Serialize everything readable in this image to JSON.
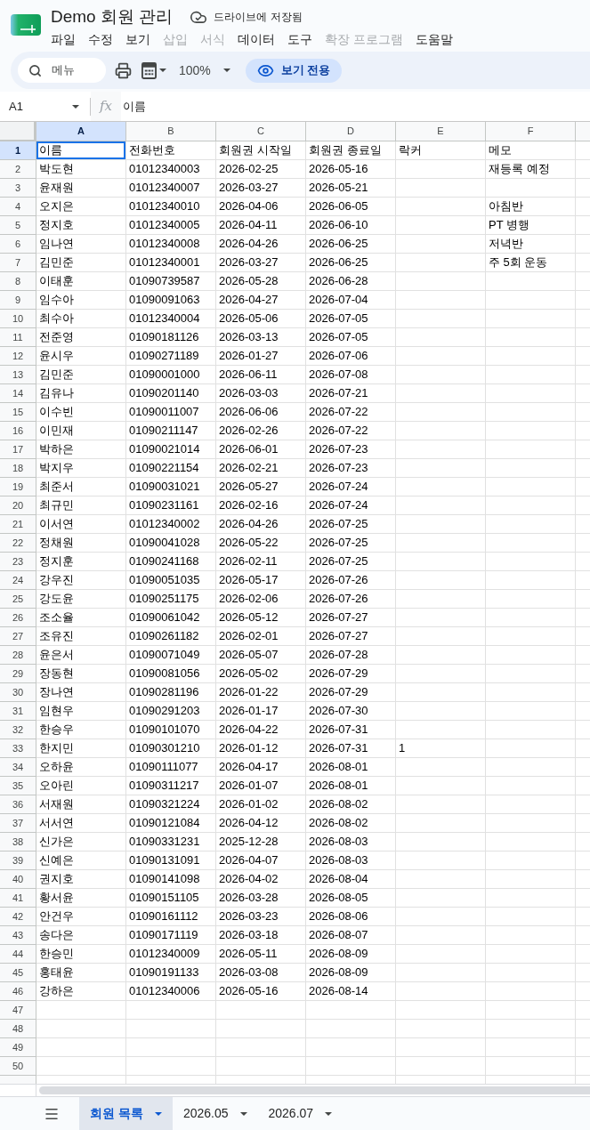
{
  "app": {
    "title": "Demo 회원 관리",
    "save_status": "드라이브에 저장됨"
  },
  "menu": [
    {
      "label": "파일",
      "disabled": false
    },
    {
      "label": "수정",
      "disabled": false
    },
    {
      "label": "보기",
      "disabled": false
    },
    {
      "label": "삽입",
      "disabled": true
    },
    {
      "label": "서식",
      "disabled": true
    },
    {
      "label": "데이터",
      "disabled": false
    },
    {
      "label": "도구",
      "disabled": false
    },
    {
      "label": "확장 프로그램",
      "disabled": true
    },
    {
      "label": "도움말",
      "disabled": false
    }
  ],
  "toolbar": {
    "search": {
      "placeholder": "메뉴"
    },
    "zoom": "100%",
    "mode_button": "보기 전용"
  },
  "formula_bar": {
    "cell_ref": "A1",
    "fx": "fx",
    "formula": "이름"
  },
  "sheet": {
    "columns": [
      {
        "label": "A",
        "selected": true
      },
      {
        "label": "B",
        "selected": false
      },
      {
        "label": "C",
        "selected": false
      },
      {
        "label": "D",
        "selected": false
      },
      {
        "label": "E",
        "selected": false
      },
      {
        "label": "F",
        "selected": false
      }
    ],
    "rows": [
      {
        "number": "1",
        "selected": true,
        "cells": [
          "이름",
          "전화번호",
          "회원권 시작일",
          "회원권 종료일",
          "락커",
          "메모"
        ]
      },
      {
        "number": "2",
        "selected": false,
        "cells": [
          "박도현",
          "01012340003",
          "2026-02-25",
          "2026-05-16",
          null,
          "재등록 예정"
        ]
      },
      {
        "number": "3",
        "selected": false,
        "cells": [
          "윤재원",
          "01012340007",
          "2026-03-27",
          "2026-05-21"
        ]
      },
      {
        "number": "4",
        "selected": false,
        "cells": [
          "오지은",
          "01012340010",
          "2026-04-06",
          "2026-06-05",
          null,
          "아침반"
        ]
      },
      {
        "number": "5",
        "selected": false,
        "cells": [
          "정지호",
          "01012340005",
          "2026-04-11",
          "2026-06-10",
          null,
          "PT 병행"
        ]
      },
      {
        "number": "6",
        "selected": false,
        "cells": [
          "임나연",
          "01012340008",
          "2026-04-26",
          "2026-06-25",
          null,
          "저녁반"
        ]
      },
      {
        "number": "7",
        "selected": false,
        "cells": [
          "김민준",
          "01012340001",
          "2026-03-27",
          "2026-06-25",
          null,
          "주 5회 운동"
        ]
      },
      {
        "number": "8",
        "selected": false,
        "cells": [
          "이태훈",
          "01090739587",
          "2026-05-28",
          "2026-06-28"
        ]
      },
      {
        "number": "9",
        "selected": false,
        "cells": [
          "임수아",
          "01090091063",
          "2026-04-27",
          "2026-07-04"
        ]
      },
      {
        "number": "10",
        "selected": false,
        "cells": [
          "최수아",
          "01012340004",
          "2026-05-06",
          "2026-07-05"
        ]
      },
      {
        "number": "11",
        "selected": false,
        "cells": [
          "전준영",
          "01090181126",
          "2026-03-13",
          "2026-07-05"
        ]
      },
      {
        "number": "12",
        "selected": false,
        "cells": [
          "윤시우",
          "01090271189",
          "2026-01-27",
          "2026-07-06"
        ]
      },
      {
        "number": "13",
        "selected": false,
        "cells": [
          "김민준",
          "01090001000",
          "2026-06-11",
          "2026-07-08"
        ]
      },
      {
        "number": "14",
        "selected": false,
        "cells": [
          "김유나",
          "01090201140",
          "2026-03-03",
          "2026-07-21"
        ]
      },
      {
        "number": "15",
        "selected": false,
        "cells": [
          "이수빈",
          "01090011007",
          "2026-06-06",
          "2026-07-22"
        ]
      },
      {
        "number": "16",
        "selected": false,
        "cells": [
          "이민재",
          "01090211147",
          "2026-02-26",
          "2026-07-22"
        ]
      },
      {
        "number": "17",
        "selected": false,
        "cells": [
          "박하은",
          "01090021014",
          "2026-06-01",
          "2026-07-23"
        ]
      },
      {
        "number": "18",
        "selected": false,
        "cells": [
          "박지우",
          "01090221154",
          "2026-02-21",
          "2026-07-23"
        ]
      },
      {
        "number": "19",
        "selected": false,
        "cells": [
          "최준서",
          "01090031021",
          "2026-05-27",
          "2026-07-24"
        ]
      },
      {
        "number": "20",
        "selected": false,
        "cells": [
          "최규민",
          "01090231161",
          "2026-02-16",
          "2026-07-24"
        ]
      },
      {
        "number": "21",
        "selected": false,
        "cells": [
          "이서연",
          "01012340002",
          "2026-04-26",
          "2026-07-25"
        ]
      },
      {
        "number": "22",
        "selected": false,
        "cells": [
          "정채원",
          "01090041028",
          "2026-05-22",
          "2026-07-25"
        ]
      },
      {
        "number": "23",
        "selected": false,
        "cells": [
          "정지훈",
          "01090241168",
          "2026-02-11",
          "2026-07-25"
        ]
      },
      {
        "number": "24",
        "selected": false,
        "cells": [
          "강우진",
          "01090051035",
          "2026-05-17",
          "2026-07-26"
        ]
      },
      {
        "number": "25",
        "selected": false,
        "cells": [
          "강도윤",
          "01090251175",
          "2026-02-06",
          "2026-07-26"
        ]
      },
      {
        "number": "26",
        "selected": false,
        "cells": [
          "조소율",
          "01090061042",
          "2026-05-12",
          "2026-07-27"
        ]
      },
      {
        "number": "27",
        "selected": false,
        "cells": [
          "조유진",
          "01090261182",
          "2026-02-01",
          "2026-07-27"
        ]
      },
      {
        "number": "28",
        "selected": false,
        "cells": [
          "윤은서",
          "01090071049",
          "2026-05-07",
          "2026-07-28"
        ]
      },
      {
        "number": "29",
        "selected": false,
        "cells": [
          "장동현",
          "01090081056",
          "2026-05-02",
          "2026-07-29"
        ]
      },
      {
        "number": "30",
        "selected": false,
        "cells": [
          "장나연",
          "01090281196",
          "2026-01-22",
          "2026-07-29"
        ]
      },
      {
        "number": "31",
        "selected": false,
        "cells": [
          "임현우",
          "01090291203",
          "2026-01-17",
          "2026-07-30"
        ]
      },
      {
        "number": "32",
        "selected": false,
        "cells": [
          "한승우",
          "01090101070",
          "2026-04-22",
          "2026-07-31"
        ]
      },
      {
        "number": "33",
        "selected": false,
        "cells": [
          "한지민",
          "01090301210",
          "2026-01-12",
          "2026-07-31",
          "1"
        ]
      },
      {
        "number": "34",
        "selected": false,
        "cells": [
          "오하윤",
          "01090111077",
          "2026-04-17",
          "2026-08-01"
        ]
      },
      {
        "number": "35",
        "selected": false,
        "cells": [
          "오아린",
          "01090311217",
          "2026-01-07",
          "2026-08-01"
        ]
      },
      {
        "number": "36",
        "selected": false,
        "cells": [
          "서재원",
          "01090321224",
          "2026-01-02",
          "2026-08-02"
        ]
      },
      {
        "number": "37",
        "selected": false,
        "cells": [
          "서서연",
          "01090121084",
          "2026-04-12",
          "2026-08-02"
        ]
      },
      {
        "number": "38",
        "selected": false,
        "cells": [
          "신가은",
          "01090331231",
          "2025-12-28",
          "2026-08-03"
        ]
      },
      {
        "number": "39",
        "selected": false,
        "cells": [
          "신예은",
          "01090131091",
          "2026-04-07",
          "2026-08-03"
        ]
      },
      {
        "number": "40",
        "selected": false,
        "cells": [
          "권지호",
          "01090141098",
          "2026-04-02",
          "2026-08-04"
        ]
      },
      {
        "number": "41",
        "selected": false,
        "cells": [
          "황서윤",
          "01090151105",
          "2026-03-28",
          "2026-08-05"
        ]
      },
      {
        "number": "42",
        "selected": false,
        "cells": [
          "안건우",
          "01090161112",
          "2026-03-23",
          "2026-08-06"
        ]
      },
      {
        "number": "43",
        "selected": false,
        "cells": [
          "송다은",
          "01090171119",
          "2026-03-18",
          "2026-08-07"
        ]
      },
      {
        "number": "44",
        "selected": false,
        "cells": [
          "한승민",
          "01012340009",
          "2026-05-11",
          "2026-08-09"
        ]
      },
      {
        "number": "45",
        "selected": false,
        "cells": [
          "홍태윤",
          "01090191133",
          "2026-03-08",
          "2026-08-09"
        ]
      },
      {
        "number": "46",
        "selected": false,
        "cells": [
          "강하은",
          "01012340006",
          "2026-05-16",
          "2026-08-14"
        ]
      },
      {
        "number": "47",
        "selected": false
      },
      {
        "number": "48",
        "selected": false
      },
      {
        "number": "49",
        "selected": false
      },
      {
        "number": "50",
        "selected": false
      }
    ]
  },
  "sheet_tabs": [
    {
      "label": "회원 목록",
      "selected": true
    },
    {
      "label": "2026.05",
      "selected": false
    },
    {
      "label": "2026.07",
      "selected": false
    }
  ]
}
